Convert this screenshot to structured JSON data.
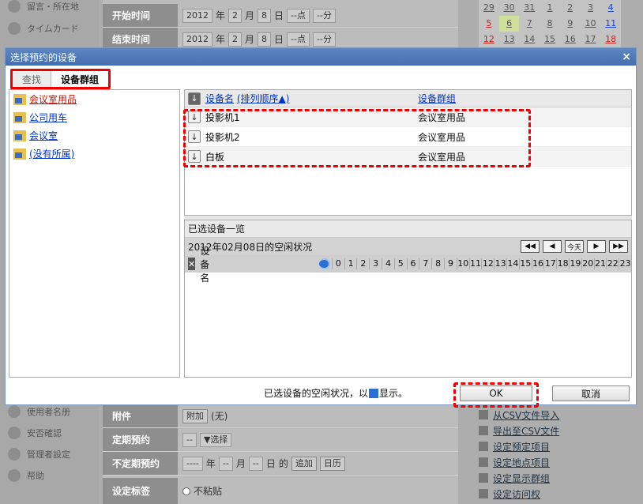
{
  "background": {
    "nav_items": [
      {
        "label": "留言・所在地",
        "icon": "location-icon"
      },
      {
        "label": "タイムカード",
        "icon": "clock-icon"
      },
      {
        "label": "使用者名册",
        "icon": "user-list-icon"
      },
      {
        "label": "安否確認",
        "icon": "safety-icon"
      },
      {
        "label": "管理者設定",
        "icon": "admin-icon"
      },
      {
        "label": "帮助",
        "icon": "help-icon"
      }
    ],
    "form": {
      "start_label": "开始时间",
      "end_label": "结束时间",
      "year": "2012",
      "year_unit": "年",
      "month": "2",
      "month_unit": "月",
      "day": "8",
      "day_unit": "日",
      "hour": "--点",
      "minute": "--分",
      "attach_label": "附件",
      "attach_button": "附加",
      "attach_none": "(无)",
      "periodic_label": "定期预约",
      "periodic_sel1": "--",
      "periodic_sel2": "▼选择",
      "irregular_label": "不定期预约",
      "irregular_year": "----",
      "irregular_month": "--",
      "irregular_day": "--",
      "irregular_de": "的",
      "irregular_add": "追加",
      "irregular_cal": "日历",
      "tag_label": "设定标签",
      "tag_none": "不粘贴"
    },
    "calendar": {
      "row1": [
        "29",
        "30",
        "31",
        "1",
        "2",
        "3",
        "4"
      ],
      "row2": [
        "5",
        "6",
        "7",
        "8",
        "9",
        "10",
        "11"
      ],
      "row3": [
        "12",
        "13",
        "14",
        "15",
        "16",
        "17",
        "18"
      ]
    },
    "right_links": [
      "从CSV文件导入",
      "导出至CSV文件",
      "设定预定项目",
      "设定地点项目",
      "设定显示群组",
      "设定访问权"
    ]
  },
  "dialog": {
    "title": "选择预约的设备",
    "close": "×",
    "tabs": [
      "查找",
      "设备群组"
    ],
    "groups": [
      "会议室用品",
      "公司用车",
      "会议室",
      "(没有所属)"
    ],
    "list_header": {
      "name": "设备名",
      "sort": "(排列顺序▲)",
      "group": "设备群组"
    },
    "rows": [
      {
        "name": "投影机1",
        "group": "会议室用品"
      },
      {
        "name": "投影机2",
        "group": "会议室用品"
      },
      {
        "name": "白板",
        "group": "会议室用品"
      }
    ],
    "selected_title": "已选设备一览",
    "date_status": "2012年02月08日的空闲状况",
    "today": "今天",
    "name_col": "设备名",
    "hours": [
      "0",
      "1",
      "2",
      "3",
      "4",
      "5",
      "6",
      "7",
      "8",
      "9",
      "10",
      "11",
      "12",
      "13",
      "14",
      "15",
      "16",
      "17",
      "18",
      "19",
      "20",
      "21",
      "22",
      "23"
    ],
    "footer_note_prefix": "已选设备的空闲状况，以",
    "footer_note_suffix": "显示。",
    "ok": "OK",
    "cancel": "取消"
  }
}
